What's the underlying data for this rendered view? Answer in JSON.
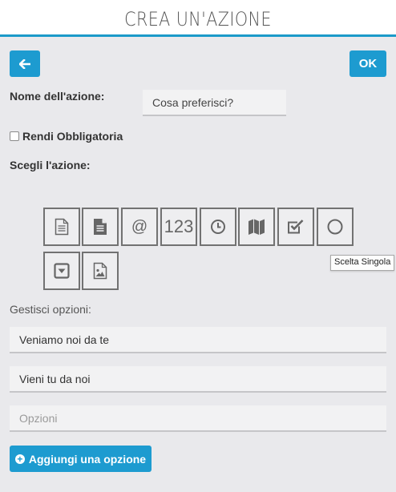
{
  "header": {
    "title": "CREA UN'AZIONE"
  },
  "toolbar": {
    "back_icon": "arrow-left-icon",
    "ok_label": "OK"
  },
  "form": {
    "name_label": "Nome dell'azione:",
    "name_value": "Cosa preferisci?",
    "required_label": "Rendi Obbligatoria",
    "required_checked": false,
    "choose_label": "Scegli l'azione:"
  },
  "action_types": [
    {
      "icon": "text-document-icon"
    },
    {
      "icon": "filled-document-icon"
    },
    {
      "icon": "email-at-icon",
      "text": "@"
    },
    {
      "icon": "number-icon",
      "text": "123"
    },
    {
      "icon": "clock-icon"
    },
    {
      "icon": "map-icon"
    },
    {
      "icon": "checkbox-icon"
    },
    {
      "icon": "radio-circle-icon"
    },
    {
      "icon": "dropdown-icon"
    },
    {
      "icon": "image-icon"
    }
  ],
  "tooltip": "Scelta Singola",
  "options": {
    "label": "Gestisci opzioni:",
    "items": [
      "Veniamo noi da te",
      "Vieni tu da noi"
    ],
    "placeholder": "Opzioni",
    "add_label": "Aggiungi una opzione"
  },
  "colors": {
    "accent": "#1d9bd0",
    "header_line": "#1b9ac9",
    "background": "#e9e9ec",
    "tile_border": "#727272"
  }
}
